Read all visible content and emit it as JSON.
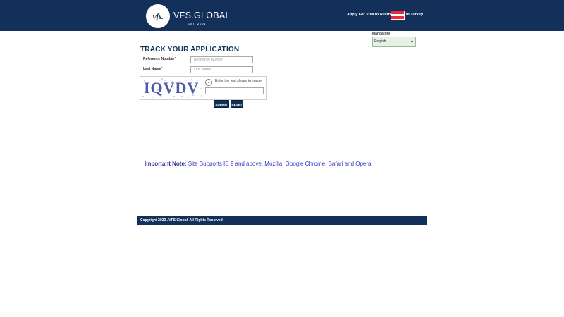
{
  "header": {
    "logo_text": "vfs.",
    "brand_name": "VFS.GLOBAL",
    "brand_est": "EST. 2001",
    "apply_text": "Apply For Visa to Austria",
    "in_text": "In Turkey",
    "flag_colors": [
      "#ed2939",
      "#ffffff",
      "#ed2939"
    ],
    "background_color": "#12305a"
  },
  "language": {
    "label": "Mandatory",
    "selected": "English"
  },
  "form": {
    "title": "TRACK YOUR APPLICATION",
    "reference_label": "Reference Number",
    "reference_placeholder": "Reference Number",
    "lastname_label": "Last Name",
    "lastname_placeholder": "Last Name",
    "required_marker": "*",
    "captcha_text": "IQVDV",
    "captcha_hint": "Enter the text shown in image",
    "submit_label": "SUBMIT",
    "reset_label": "RESET"
  },
  "note": {
    "label": "Important Note:",
    "text": " Site Supports IE 9 and above, Mozilla, Google Chrome, Safari and Opera."
  },
  "footer": {
    "copyright": "Copyright 2022 . VFS Global. All Rights Reserved."
  }
}
